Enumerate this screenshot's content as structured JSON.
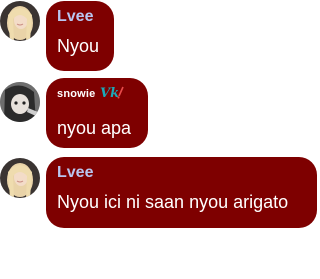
{
  "messages": [
    {
      "author": "Lvee",
      "author_color": "#b9c6f0",
      "text": "Nyou",
      "avatar": "blonde-girl-avatar"
    },
    {
      "author": "snowie",
      "author_color": "#ffffff",
      "badge": "Vk!",
      "badge_color": "#1aa9b8",
      "text": "nyou apa",
      "avatar": "anime-girl-avatar"
    },
    {
      "author": "Lvee",
      "author_color": "#b9c6f0",
      "text": "Nyou ici ni saan nyou arigato",
      "avatar": "blonde-girl-avatar"
    }
  ],
  "colors": {
    "bubble": "#7e0000",
    "text": "#ffffff",
    "background": "#ffffff"
  }
}
